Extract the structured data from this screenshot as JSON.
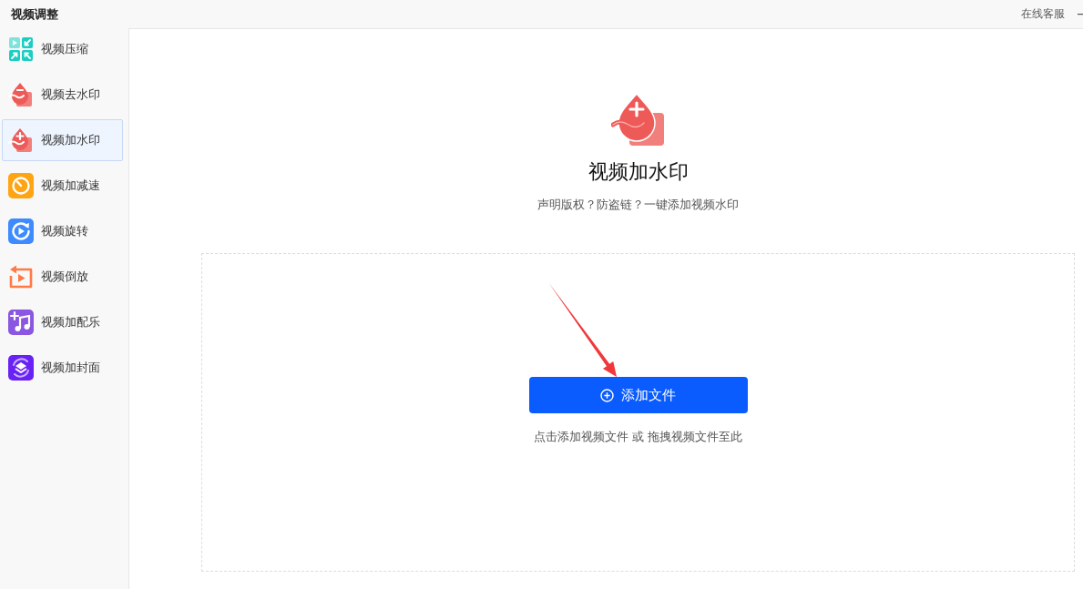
{
  "window": {
    "title": "视频调整",
    "links": [
      "在线客服"
    ]
  },
  "sidebar": {
    "items": [
      {
        "label": "视频压缩",
        "selected": false
      },
      {
        "label": "视频去水印",
        "selected": false
      },
      {
        "label": "视频加水印",
        "selected": true
      },
      {
        "label": "视频加减速",
        "selected": false
      },
      {
        "label": "视频旋转",
        "selected": false
      },
      {
        "label": "视频倒放",
        "selected": false
      },
      {
        "label": "视频加配乐",
        "selected": false
      },
      {
        "label": "视频加封面",
        "selected": false
      }
    ]
  },
  "main": {
    "title": "视频加水印",
    "subtitle": "声明版权？防盗链？一键添加视频水印",
    "upload_area": {
      "button": "添加文件",
      "hint": "点击添加视频文件 或 拖拽视频文件至此"
    }
  }
}
